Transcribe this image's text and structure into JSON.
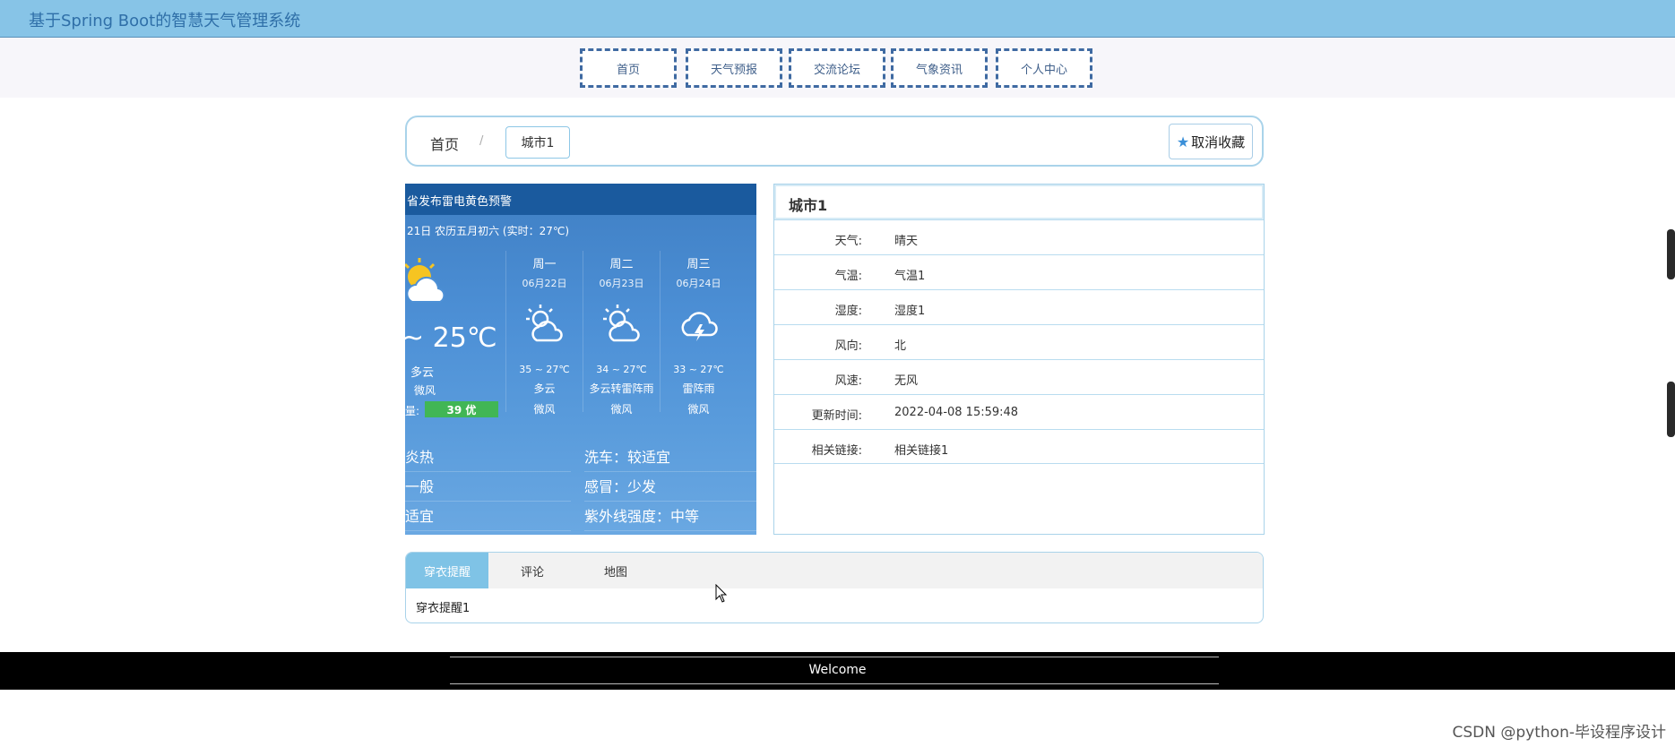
{
  "header": {
    "title": "基于Spring Boot的智慧天气管理系统"
  },
  "nav": {
    "items": [
      "首页",
      "天气预报",
      "交流论坛",
      "气象资讯",
      "个人中心"
    ]
  },
  "breadcrumb": {
    "home": "首页",
    "separator": "/",
    "current": "城市1",
    "favorite_label": "取消收藏"
  },
  "widget": {
    "alert": "省发布雷电黄色预警",
    "date_line": "21日 农历五月初六 (实时：27℃)",
    "today": {
      "temp": "~ 25℃",
      "cond": "多云",
      "wind": "微风",
      "aqi_label": "量:",
      "aqi": "39 优"
    },
    "days": [
      {
        "name": "周一",
        "date": "06月22日",
        "temp": "35 ~ 27℃",
        "cond": "多云",
        "wind": "微风",
        "icon": "partly-sunny-icon"
      },
      {
        "name": "周二",
        "date": "06月23日",
        "temp": "34 ~ 27℃",
        "cond": "多云转雷阵雨",
        "wind": "微风",
        "icon": "partly-sunny-icon"
      },
      {
        "name": "周三",
        "date": "06月24日",
        "temp": "33 ~ 27℃",
        "cond": "雷阵雨",
        "wind": "微风",
        "icon": "thunderstorm-icon"
      }
    ],
    "tips": [
      "炎热",
      "洗车：较适宜",
      "一般",
      "感冒：少发",
      "适宜",
      "紫外线强度：中等"
    ]
  },
  "info": {
    "title": "城市1",
    "rows": [
      {
        "k": "天气:",
        "v": "晴天"
      },
      {
        "k": "气温:",
        "v": "气温1"
      },
      {
        "k": "湿度:",
        "v": "湿度1"
      },
      {
        "k": "风向:",
        "v": "北"
      },
      {
        "k": "风速:",
        "v": "无风"
      },
      {
        "k": "更新时间:",
        "v": "2022-04-08 15:59:48"
      },
      {
        "k": "相关链接:",
        "v": "相关链接1"
      }
    ]
  },
  "tabs": {
    "items": [
      "穿衣提醒",
      "评论",
      "地图"
    ],
    "active": 0,
    "content": "穿衣提醒1"
  },
  "footer": {
    "text": "Welcome"
  },
  "watermark": "CSDN @python-毕设程序设计",
  "colors": {
    "header_bg": "#87c4e7",
    "nav_border": "#3f6aa2",
    "tab_active": "#7fc3e6",
    "aqi_green": "#41b655"
  }
}
